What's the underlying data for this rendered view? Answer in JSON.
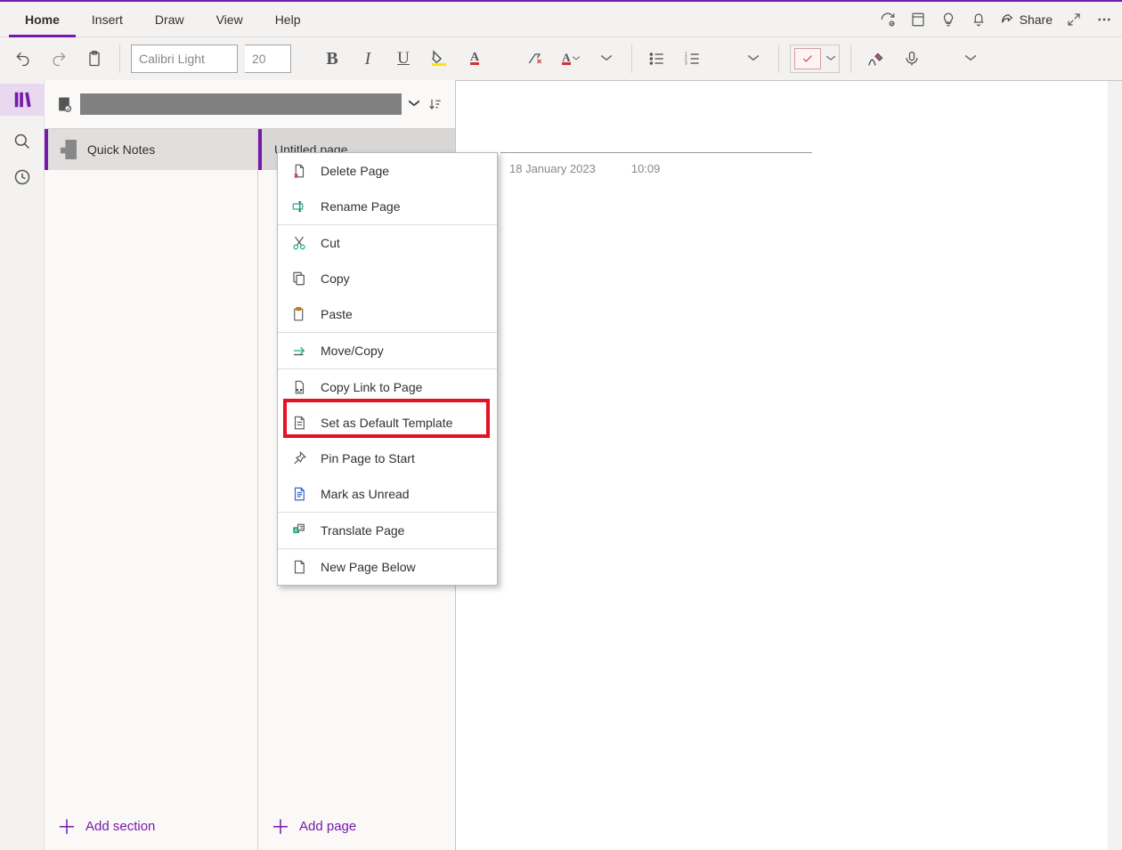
{
  "tabs": {
    "home": "Home",
    "insert": "Insert",
    "draw": "Draw",
    "view": "View",
    "help": "Help"
  },
  "title_actions": {
    "share": "Share"
  },
  "ribbon": {
    "font_name": "Calibri Light",
    "font_size": "20"
  },
  "notebook": {
    "section_name": "Quick Notes",
    "page_name": "Untitled page"
  },
  "nav_bottom": {
    "add_section": "Add section",
    "add_page": "Add page"
  },
  "page": {
    "date": "18 January 2023",
    "time": "10:09"
  },
  "context_menu": {
    "delete": "Delete Page",
    "rename": "Rename Page",
    "cut": "Cut",
    "copy": "Copy",
    "paste": "Paste",
    "move": "Move/Copy",
    "copylink": "Copy Link to Page",
    "default_template": "Set as Default Template",
    "pin": "Pin Page to Start",
    "unread": "Mark as Unread",
    "translate": "Translate Page",
    "newbelow": "New Page Below"
  }
}
